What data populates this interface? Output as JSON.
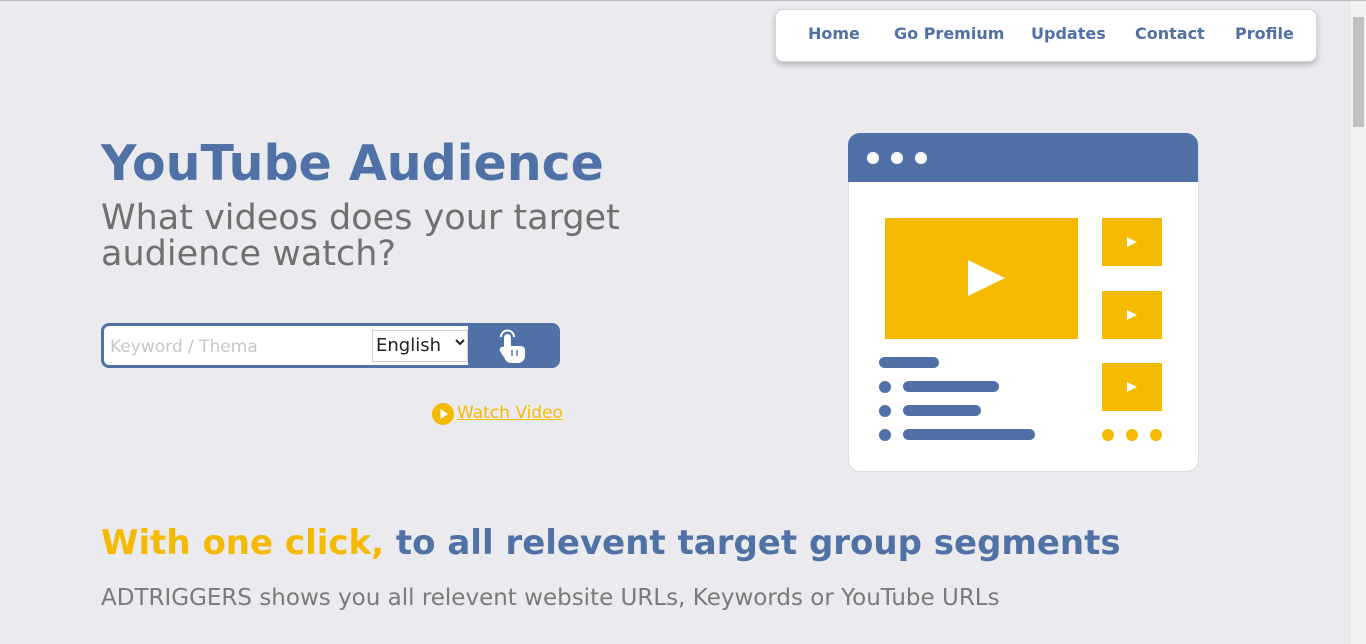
{
  "nav": {
    "items": [
      {
        "label": "Home"
      },
      {
        "label": "Go Premium"
      },
      {
        "label": "Updates"
      },
      {
        "label": "Contact"
      },
      {
        "label": "Profile"
      }
    ]
  },
  "hero": {
    "title": "YouTube Audience",
    "subtitle": "What videos does your target audience watch?"
  },
  "search": {
    "placeholder": "Keyword / Thema",
    "value": "",
    "language": "English",
    "button_icon": "pointer-hand-icon"
  },
  "watch_video": {
    "label": "Watch Video",
    "icon": "play-circle-icon"
  },
  "section": {
    "heading_accent": "With one click,",
    "heading_main": " to all relevent target group segments",
    "text": "ADTRIGGERS shows you all relevent website URLs, Keywords or YouTube URLs"
  },
  "colors": {
    "brand_blue": "#4f71a5",
    "accent_yellow": "#f5ba00",
    "background": "#ebeaee"
  }
}
